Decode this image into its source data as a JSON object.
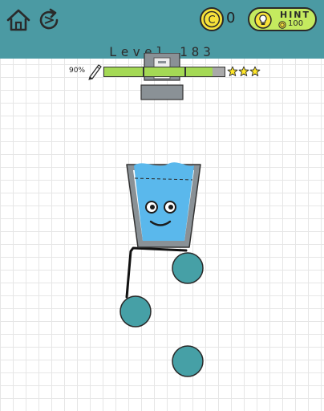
{
  "toolbar": {
    "home_icon": "home-icon",
    "restart_icon": "restart-icon",
    "coin_icon": "coin-icon",
    "coin_symbol": "C",
    "coin_count": "0"
  },
  "hint": {
    "label": "HINT",
    "cost": "100",
    "icon": "lightbulb-icon"
  },
  "level": {
    "title": "Level 183"
  },
  "progress": {
    "percent_label": "90%",
    "fill_percent": 90,
    "pencil_icon": "pencil-icon",
    "stars": 3
  },
  "colors": {
    "header": "#4b9aa3",
    "accent_green": "#c4ea5f",
    "coin_yellow": "#f7e23a",
    "water_blue": "#5ab8ec",
    "ball_teal": "#46a0a6",
    "glass_gray": "#8a9196",
    "star_yellow": "#ffe629"
  },
  "scene": {
    "cup_face": "smiley-face",
    "balls": 3,
    "drawn_line": "black-pencil-line"
  }
}
